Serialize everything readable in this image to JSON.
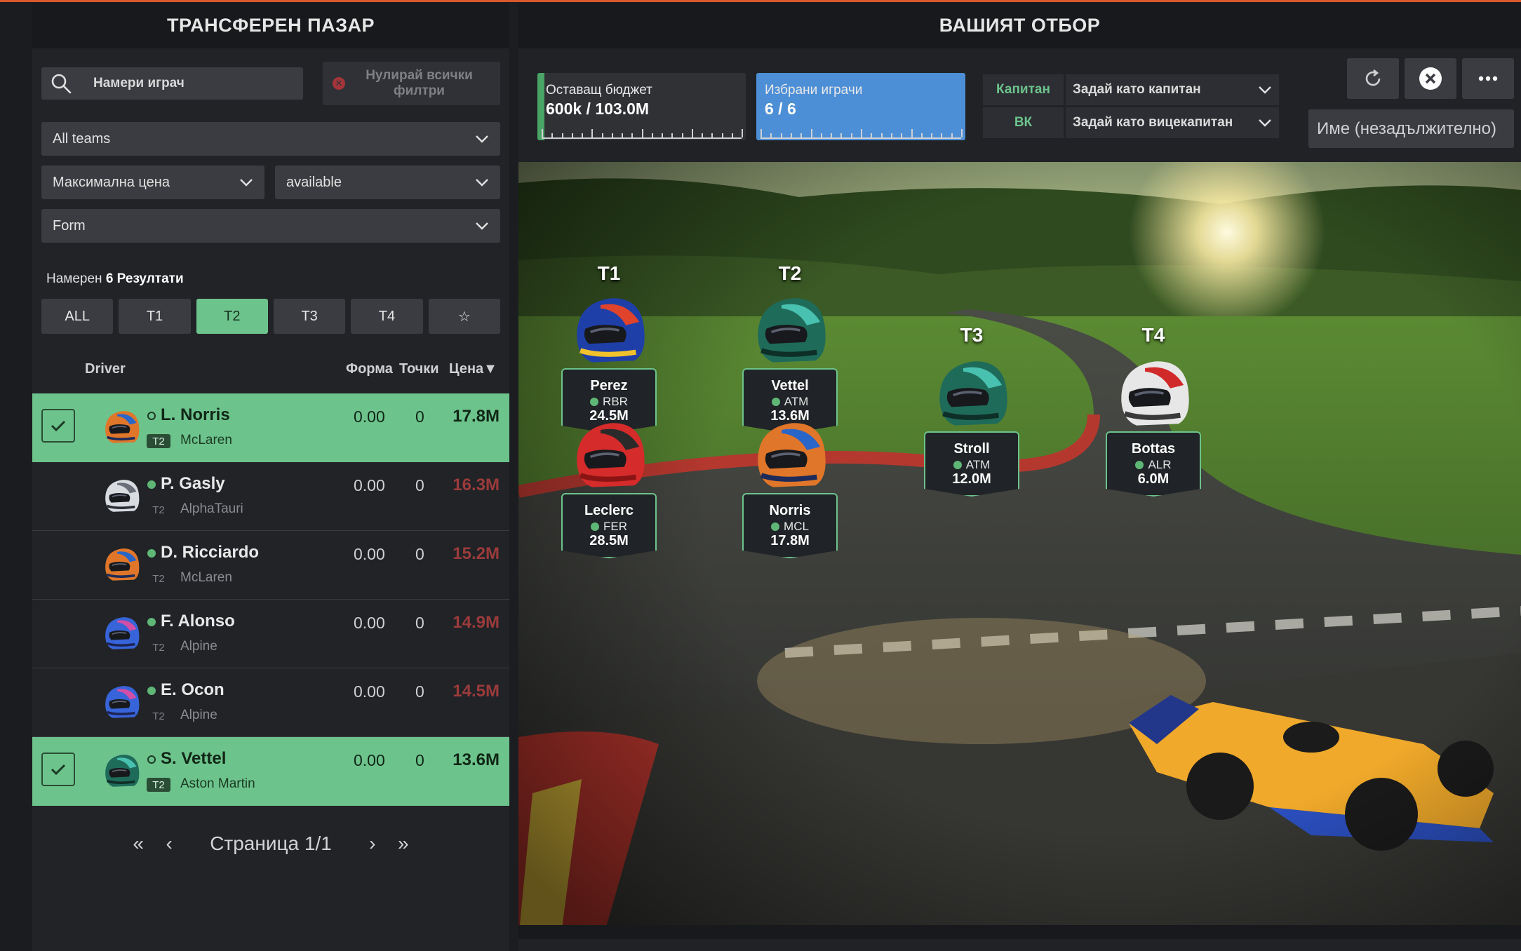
{
  "market": {
    "title": "ТРАНСФЕРЕН ПАЗАР",
    "search_placeholder": "Намери играч",
    "reset_label": "Нулирай всички филтри",
    "team_filter": "All teams",
    "price_filter": "Максимална цена",
    "availability_filter": "available",
    "form_filter": "Form",
    "results_prefix": "Намерен",
    "results_count": "6 Резултати",
    "tabs": [
      "ALL",
      "T1",
      "T2",
      "T3",
      "T4",
      "☆"
    ],
    "active_tab": "T2",
    "columns": {
      "driver": "Driver",
      "form": "Форма",
      "points": "Точки",
      "price": "Цена▼"
    },
    "drivers": [
      {
        "name": "L. Norris",
        "tier": "T2",
        "team": "McLaren",
        "form": "0.00",
        "points": "0",
        "price": "17.8M",
        "selected": true,
        "helmet": "orange-blue"
      },
      {
        "name": "P. Gasly",
        "tier": "T2",
        "team": "AlphaTauri",
        "form": "0.00",
        "points": "0",
        "price": "16.3M",
        "selected": false,
        "helmet": "white-grey"
      },
      {
        "name": "D. Ricciardo",
        "tier": "T2",
        "team": "McLaren",
        "form": "0.00",
        "points": "0",
        "price": "15.2M",
        "selected": false,
        "helmet": "orange-blue"
      },
      {
        "name": "F. Alonso",
        "tier": "T2",
        "team": "Alpine",
        "form": "0.00",
        "points": "0",
        "price": "14.9M",
        "selected": false,
        "helmet": "blue-pink"
      },
      {
        "name": "E. Ocon",
        "tier": "T2",
        "team": "Alpine",
        "form": "0.00",
        "points": "0",
        "price": "14.5M",
        "selected": false,
        "helmet": "blue-pink"
      },
      {
        "name": "S. Vettel",
        "tier": "T2",
        "team": "Aston Martin",
        "form": "0.00",
        "points": "0",
        "price": "13.6M",
        "selected": true,
        "helmet": "green"
      }
    ],
    "pager": {
      "label": "Страница 1/1"
    }
  },
  "team": {
    "title": "ВАШИЯТ ОТБОР",
    "budget": {
      "label": "Оставащ бюджет",
      "value": "600k / 103.0M",
      "fraction": 0.006
    },
    "picked": {
      "label": "Избрани играчи",
      "value": "6 / 6",
      "fraction": 1.0
    },
    "captain": {
      "key": "Капитан",
      "value": "Задай като капитан"
    },
    "vice": {
      "key": "ВК",
      "value": "Задай като вицекапитан"
    },
    "name_placeholder": "Име (незадължително)",
    "tiers": [
      "T1",
      "T2",
      "T3",
      "T4"
    ],
    "cards": [
      {
        "name": "Perez",
        "team": "RBR",
        "price": "24.5M",
        "helmet": "red-blue"
      },
      {
        "name": "Leclerc",
        "team": "FER",
        "price": "28.5M",
        "helmet": "red"
      },
      {
        "name": "Vettel",
        "team": "ATM",
        "price": "13.6M",
        "helmet": "green"
      },
      {
        "name": "Norris",
        "team": "MCL",
        "price": "17.8M",
        "helmet": "orange-blue"
      },
      {
        "name": "Stroll",
        "team": "ATM",
        "price": "12.0M",
        "helmet": "green"
      },
      {
        "name": "Bottas",
        "team": "ALR",
        "price": "6.0M",
        "helmet": "red-white"
      }
    ]
  },
  "colors": {
    "accent": "#6dc38c",
    "price_red": "#9b3b3b",
    "picked_blue": "#4d8fd6"
  }
}
